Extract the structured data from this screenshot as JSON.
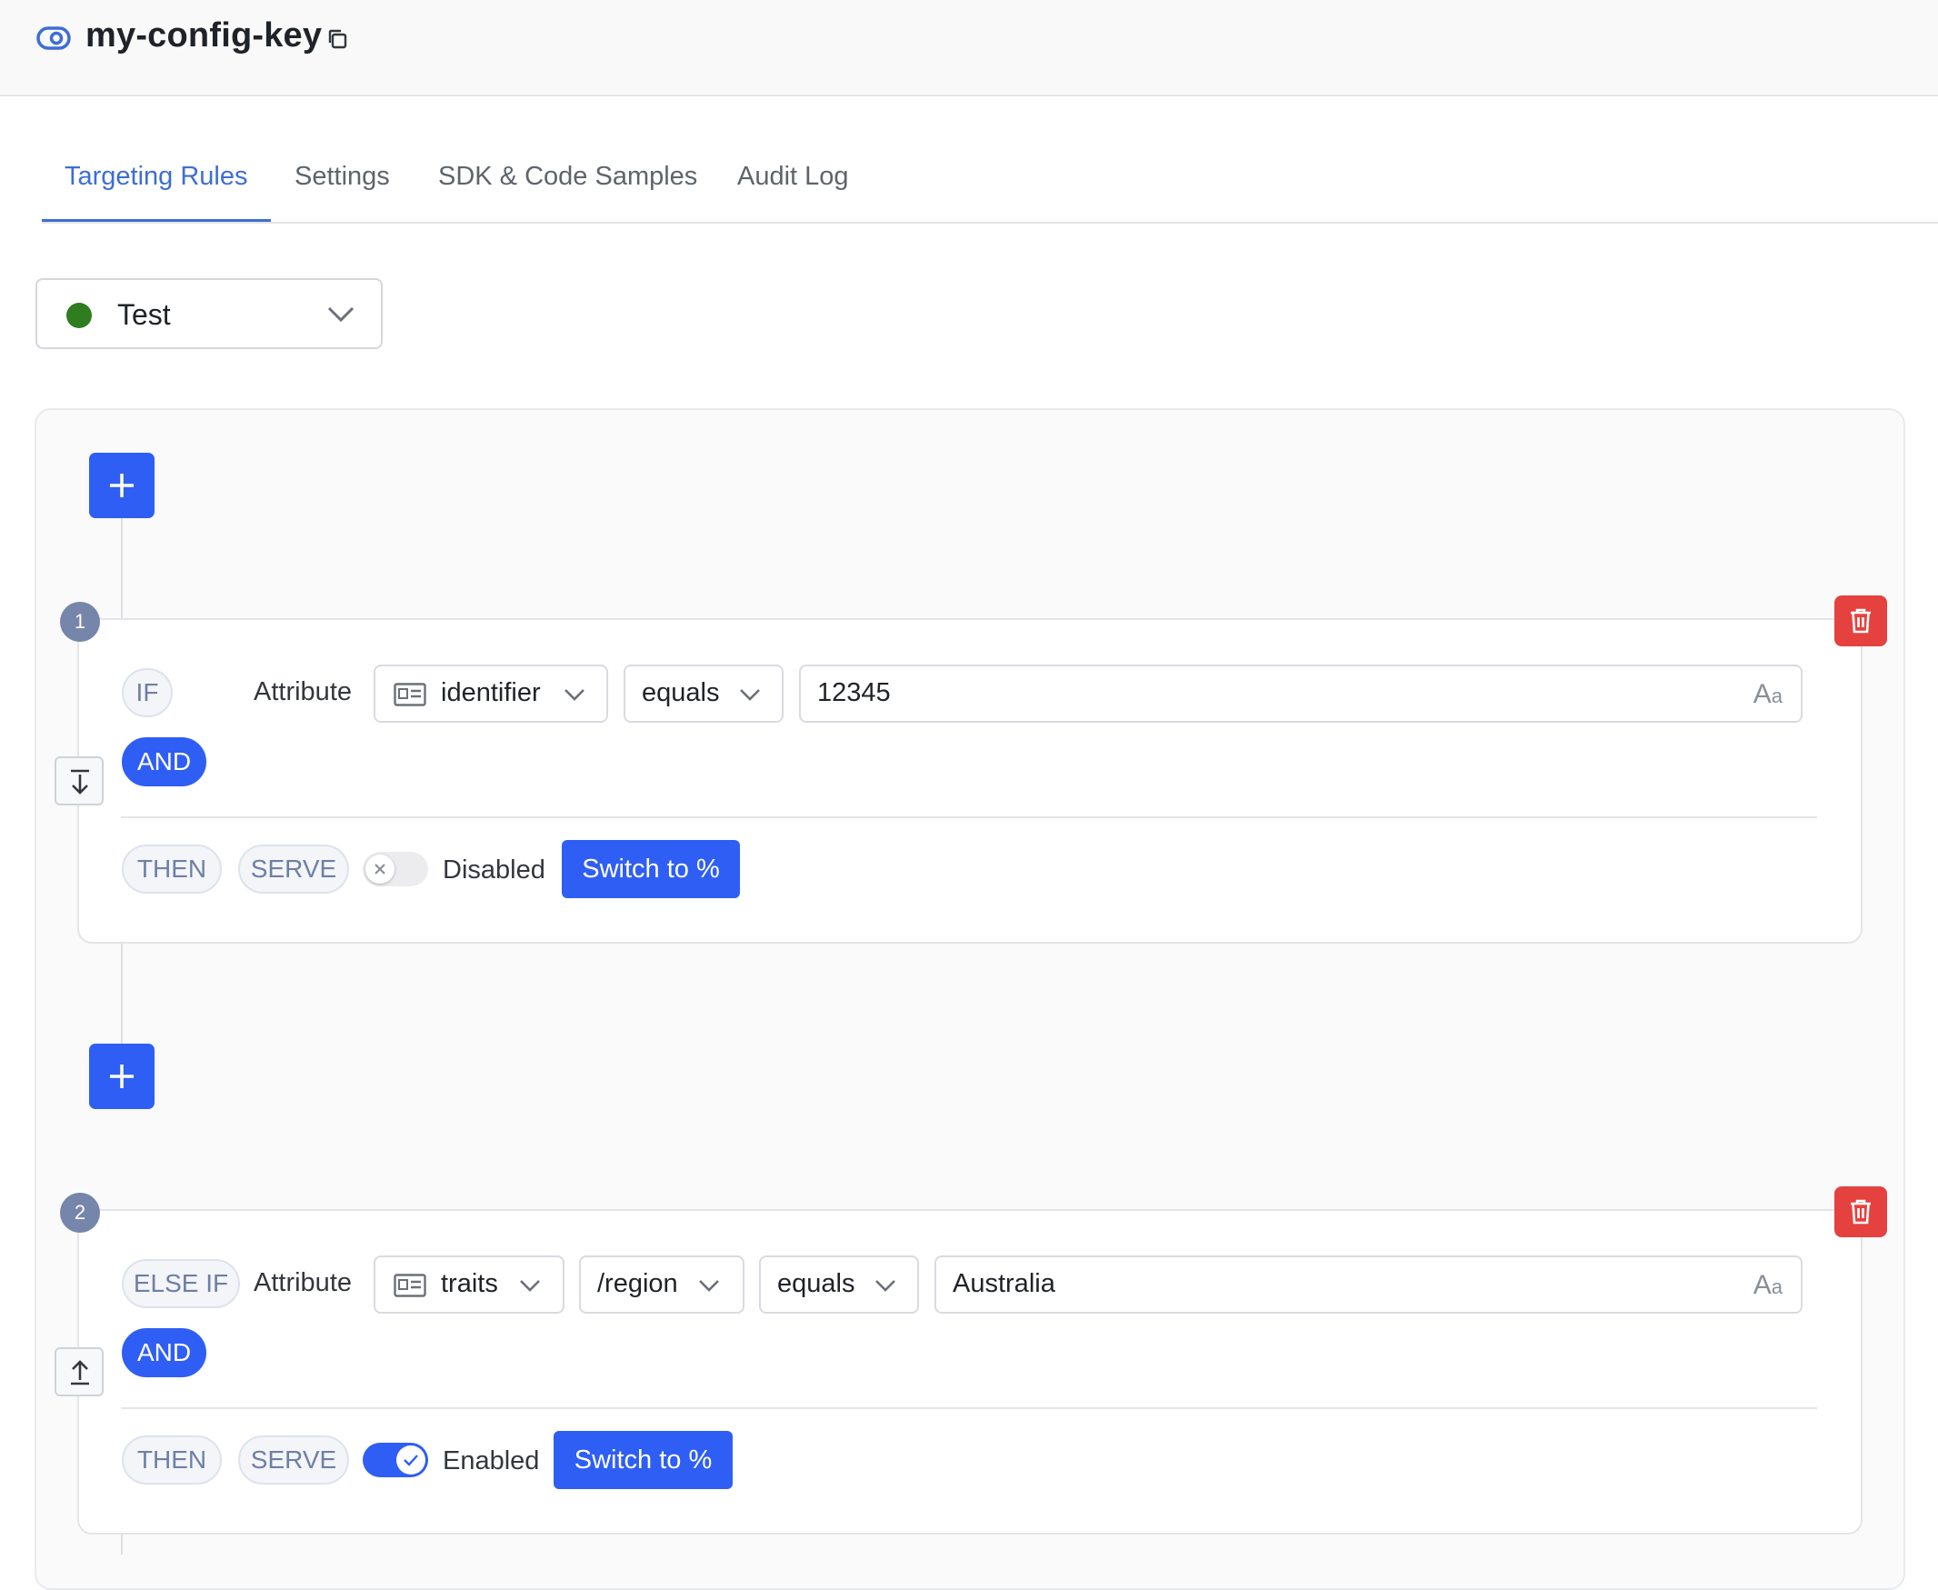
{
  "header": {
    "title": "my-config-key"
  },
  "tabs": [
    {
      "label": "Targeting Rules"
    },
    {
      "label": "Settings"
    },
    {
      "label": "SDK & Code Samples"
    },
    {
      "label": "Audit Log"
    }
  ],
  "environment": {
    "label": "Test",
    "status_color": "#2e7d1f"
  },
  "rules": [
    {
      "number": "1",
      "keyword": "IF",
      "attribute_label": "Attribute",
      "attribute": "identifier",
      "operator": "equals",
      "value": "12345",
      "and_label": "AND",
      "then_label": "THEN",
      "serve_label": "SERVE",
      "toggle_state": "Disabled",
      "switch_label": "Switch to %"
    },
    {
      "number": "2",
      "keyword": "ELSE IF",
      "attribute_label": "Attribute",
      "attribute": "traits",
      "trait_path": "/region",
      "operator": "equals",
      "value": "Australia",
      "and_label": "AND",
      "then_label": "THEN",
      "serve_label": "SERVE",
      "toggle_state": "Enabled",
      "switch_label": "Switch to %"
    }
  ],
  "type_indicator": {
    "big": "A",
    "small": "a"
  },
  "colors": {
    "accent": "#2f5ef5",
    "danger": "#e5413f",
    "tab_active": "#3e6ed3"
  }
}
